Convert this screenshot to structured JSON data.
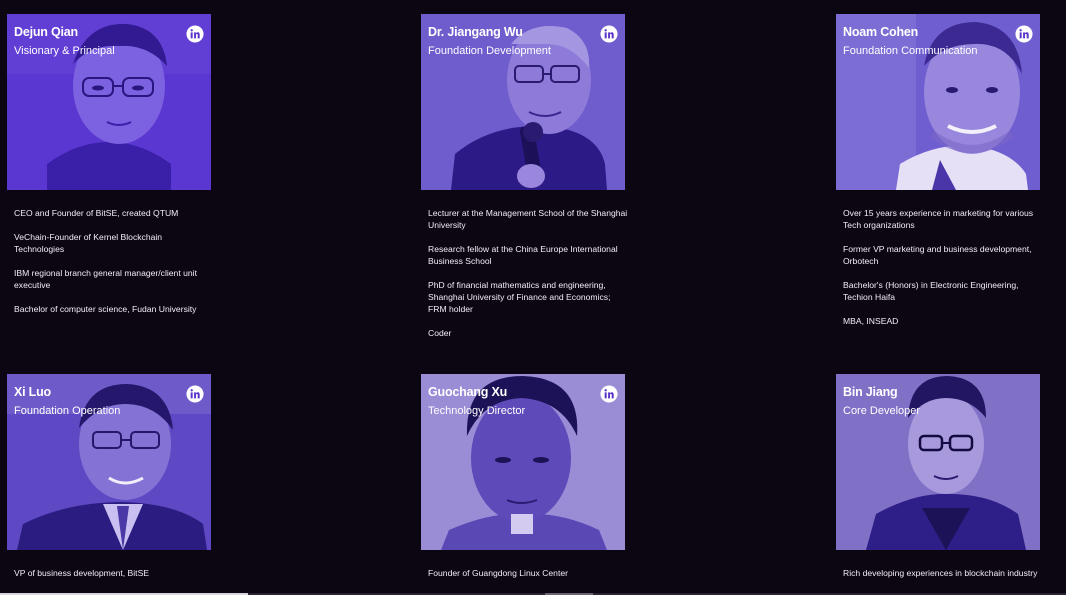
{
  "team": [
    {
      "name": "Dejun Qian",
      "role": "Visionary & Principal",
      "linkedin_icon": "linkedin-icon",
      "bio": [
        "CEO and Founder of BitSE, created QTUM",
        " VeChain-Founder of Kernel Blockchain Technologies",
        "IBM regional branch general manager/client unit executive",
        "Bachelor of computer science, Fudan University"
      ]
    },
    {
      "name": "Dr. Jiangang Wu",
      "role": "Foundation Development",
      "linkedin_icon": "linkedin-icon",
      "bio": [
        "Lecturer at the Management School of the Shanghai University",
        "Research fellow at the China Europe International Business School",
        "PhD of financial mathematics and engineering, Shanghai University of Finance and Economics; FRM holder",
        "Coder"
      ]
    },
    {
      "name": "Noam Cohen",
      "role": "Foundation Communication",
      "linkedin_icon": "linkedin-icon",
      "bio": [
        "Over 15 years experience in marketing for various Tech organizations",
        "Former VP marketing and business development, Orbotech",
        "Bachelor's (Honors) in Electronic Engineering, Techion Haifa",
        "MBA, INSEAD"
      ]
    },
    {
      "name": "Xi Luo",
      "role": "Foundation Operation",
      "linkedin_icon": "linkedin-icon",
      "bio": [
        "VP of business development, BitSE"
      ]
    },
    {
      "name": "Guochang Xu",
      "role": "Technology Director",
      "linkedin_icon": "linkedin-icon",
      "bio": [
        "Founder of Guangdong Linux Center"
      ]
    },
    {
      "name": "Bin Jiang",
      "role": "Core Developer",
      "linkedin_icon": "linkedin-icon",
      "bio": [
        "Rich developing experiences in blockchain industry"
      ]
    }
  ],
  "colors": {
    "page_background": "#0c0512",
    "photo_tint": "#5a33c9",
    "photo_tint_light": "#8f7fd0",
    "text": "#ffffff"
  }
}
